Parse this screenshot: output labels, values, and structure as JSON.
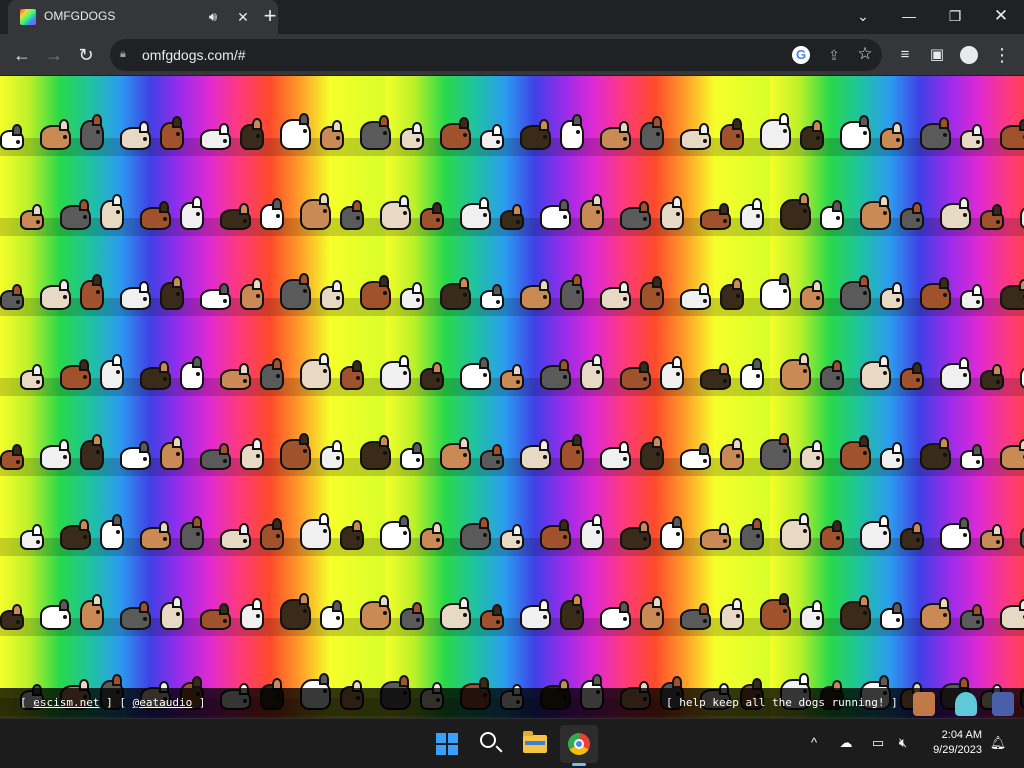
{
  "browser": {
    "tab": {
      "title": "OMFGDOGS",
      "audio_icon": "speaker-icon",
      "close_icon": "close-icon"
    },
    "new_tab_icon": "plus-icon",
    "window_controls": [
      "tab-list-icon",
      "minimize-icon",
      "restore-icon",
      "close-icon"
    ],
    "address": {
      "url": "omfgdogs.com/#",
      "lock_icon": "lock-icon"
    },
    "address_actions": [
      "google-lens-icon",
      "share-icon",
      "bookmark-star-icon"
    ],
    "toolbar_icons": [
      "media-control-icon",
      "side-panel-icon",
      "profile-icon",
      "more-menu-icon"
    ]
  },
  "page": {
    "footer_left": {
      "open1": "[",
      "link1": "escism.net",
      "sep": "] [",
      "link2": "@eataudio",
      "close2": "]"
    },
    "footer_right": "[ help keep all the dogs running! ]",
    "background_colors": [
      "#f6ff2a",
      "#28d94a",
      "#2b9cf0",
      "#4040e6",
      "#9b2bea",
      "#e02ad1",
      "#ff3a7a",
      "#ff9d2a"
    ]
  },
  "taskbar": {
    "apps": [
      "windows-start-icon",
      "search-icon",
      "file-explorer-icon",
      "chrome-icon"
    ],
    "tray": [
      "chevron-up-icon",
      "onedrive-icon",
      "display-icon",
      "volume-muted-icon",
      "notification-bell-icon"
    ],
    "time": "2:04 AM",
    "date": "9/29/2023"
  }
}
